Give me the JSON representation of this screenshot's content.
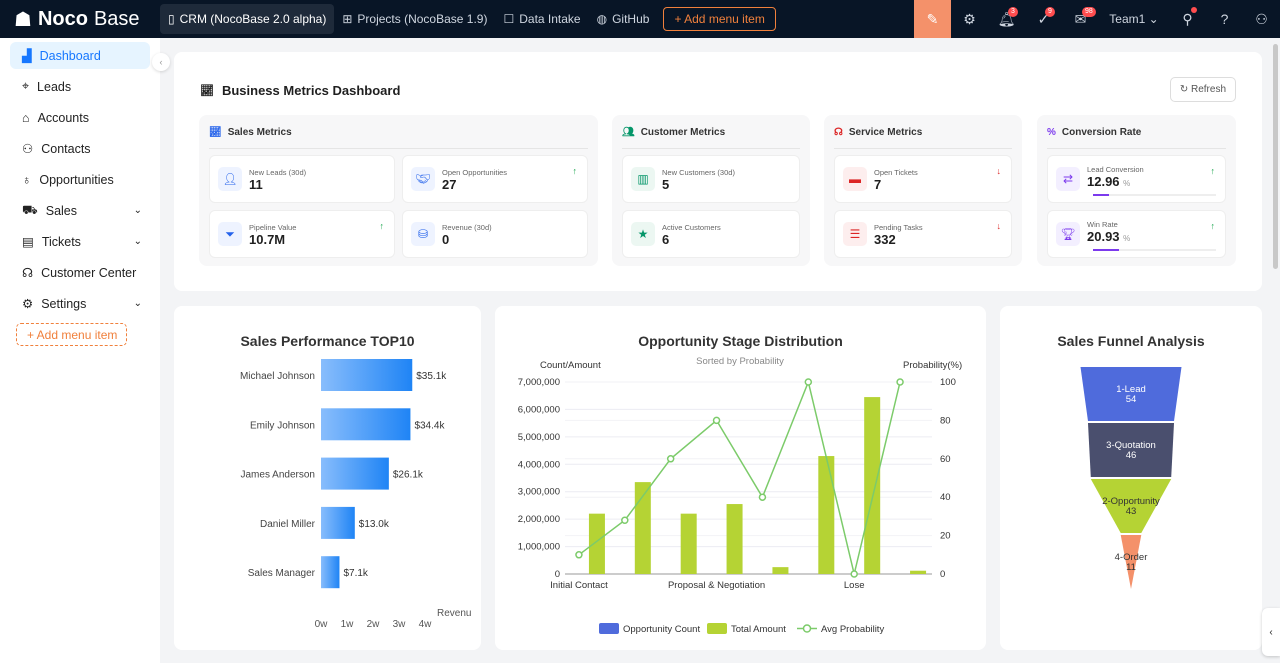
{
  "header": {
    "logo": "NocoBase",
    "tabs": [
      {
        "label": "CRM (NocoBase 2.0 alpha)",
        "icon": "file-icon",
        "active": true
      },
      {
        "label": "Projects (NocoBase 1.9)",
        "icon": "apartment-icon"
      },
      {
        "label": "Data Intake",
        "icon": "form-icon"
      },
      {
        "label": "GitHub",
        "icon": "github-icon"
      }
    ],
    "add_menu": "+ Add menu item",
    "badges": {
      "notifications": "3",
      "tasks": "9",
      "mail": "98"
    },
    "team": "Team1",
    "accent": "#f4916a"
  },
  "sidebar": {
    "items": [
      {
        "label": "Dashboard",
        "icon": "area-chart-icon",
        "active": true
      },
      {
        "label": "Leads",
        "icon": "aim-icon"
      },
      {
        "label": "Accounts",
        "icon": "bank-icon"
      },
      {
        "label": "Contacts",
        "icon": "team-icon"
      },
      {
        "label": "Opportunities",
        "icon": "bulb-icon"
      },
      {
        "label": "Sales",
        "icon": "cart-icon",
        "expandable": true
      },
      {
        "label": "Tickets",
        "icon": "ticket-icon",
        "expandable": true
      },
      {
        "label": "Customer Center",
        "icon": "headset-icon"
      },
      {
        "label": "Settings",
        "icon": "gear-icon",
        "expandable": true
      }
    ],
    "add_menu": "+ Add menu item"
  },
  "dashboard": {
    "title": "Business Metrics Dashboard",
    "refresh": "Refresh",
    "groups": [
      {
        "title": "Sales Metrics",
        "color": "#2563eb",
        "metrics": [
          {
            "label": "New Leads (30d)",
            "value": "11"
          },
          {
            "label": "Open Opportunities",
            "value": "27",
            "trend": "up"
          },
          {
            "label": "Pipeline Value",
            "value": "10.7M",
            "trend": "up"
          },
          {
            "label": "Revenue (30d)",
            "value": "0"
          }
        ]
      },
      {
        "title": "Customer Metrics",
        "color": "#059669",
        "metrics": [
          {
            "label": "New Customers (30d)",
            "value": "5"
          },
          {
            "label": "Active Customers",
            "value": "6"
          }
        ]
      },
      {
        "title": "Service Metrics",
        "color": "#dc2626",
        "metrics": [
          {
            "label": "Open Tickets",
            "value": "7",
            "trend": "down"
          },
          {
            "label": "Pending Tasks",
            "value": "332",
            "trend": "down"
          }
        ]
      },
      {
        "title": "Conversion Rate",
        "color": "#7c3aed",
        "metrics": [
          {
            "label": "Lead Conversion",
            "value": "12.96",
            "unit": "%",
            "trend": "up",
            "progress": 12.96
          },
          {
            "label": "Win Rate",
            "value": "20.93",
            "unit": "%",
            "trend": "up",
            "progress": 20.93
          }
        ]
      }
    ]
  },
  "chart_data": [
    {
      "type": "bar",
      "orientation": "horizontal",
      "title": "Sales Performance TOP10",
      "categories": [
        "Michael Johnson",
        "Emily Johnson",
        "James Anderson",
        "Daniel Miller",
        "Sales Manager"
      ],
      "values": [
        35100,
        34400,
        26100,
        13000,
        7100
      ],
      "data_labels": [
        "$35.1k",
        "$34.4k",
        "$26.1k",
        "$13.0k",
        "$7.1k"
      ],
      "xlabel": "Revenu",
      "xticks": [
        "0w",
        "1w",
        "2w",
        "3w",
        "4w"
      ],
      "xlim": [
        0,
        40000
      ],
      "grid": true
    },
    {
      "type": "bar+line",
      "title": "Opportunity Stage Distribution",
      "subtitle": "Sorted by Probability",
      "ylabel_left": "Count/Amount",
      "ylabel_right": "Probability(%)",
      "xtick_labels": [
        "Initial Contact",
        "",
        "",
        "Proposal & Negotiation",
        "",
        "",
        "Lose",
        ""
      ],
      "ylim_left": [
        0,
        7000000
      ],
      "yticks_left": [
        "0",
        "1,000,000",
        "2,000,000",
        "3,000,000",
        "4,000,000",
        "5,000,000",
        "6,000,000",
        "7,000,000"
      ],
      "ylim_right": [
        0,
        100
      ],
      "yticks_right": [
        "0",
        "20",
        "40",
        "60",
        "80",
        "100"
      ],
      "series": [
        {
          "name": "Opportunity Count",
          "type": "bar",
          "color": "#4f6bdc",
          "values": [
            0,
            0,
            0,
            0,
            0,
            0,
            0,
            0
          ]
        },
        {
          "name": "Total Amount",
          "type": "bar",
          "color": "#b5d334",
          "values": [
            2200000,
            3350000,
            2200000,
            2550000,
            250000,
            4300000,
            6450000,
            120000
          ]
        },
        {
          "name": "Avg Probability",
          "type": "line",
          "color": "#7ccb6a",
          "values": [
            10,
            28,
            60,
            80,
            40,
            100,
            0,
            100
          ]
        }
      ],
      "legend": "bottom",
      "grid": true
    },
    {
      "type": "funnel",
      "title": "Sales Funnel Analysis",
      "categories": [
        "1-Lead",
        "3-Quotation",
        "2-Opportunity",
        "4-Order"
      ],
      "values": [
        54,
        46,
        43,
        11
      ],
      "colors": [
        "#4f6bdc",
        "#4a4f6e",
        "#b5d334",
        "#f4916a"
      ]
    }
  ]
}
